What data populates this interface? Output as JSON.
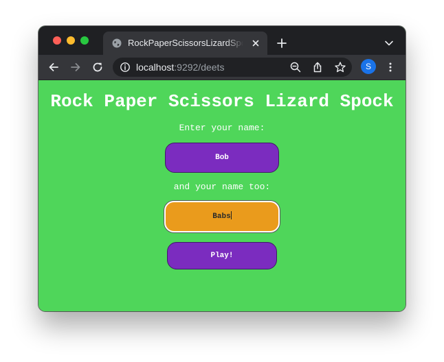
{
  "browser": {
    "tab_title": "RockPaperScissorsLizardSpock",
    "url_host": "localhost",
    "url_rest": ":9292/deets",
    "profile_initial": "S",
    "colors": {
      "tabbar_bg": "#1f2023",
      "toolbar_bg": "#35363a",
      "profile_avatar": "#1a73e8"
    },
    "icons": [
      "globe-icon",
      "close-icon",
      "plus-icon",
      "chevron-down-icon",
      "back-arrow-icon",
      "forward-arrow-icon",
      "reload-icon",
      "info-icon",
      "zoom-out-icon",
      "share-icon",
      "star-icon",
      "more-vert-icon"
    ]
  },
  "page": {
    "title": "Rock Paper Scissors Lizard Spock",
    "player1_label": "Enter your name:",
    "player1_value": "Bob",
    "player2_label": "and your name too:",
    "player2_value": "Babs",
    "play_button": "Play!",
    "colors": {
      "background": "#4fd65a",
      "field_purple": "#7b2cbf",
      "field_orange_focused": "#ea9b1c",
      "text": "#ffffff"
    }
  }
}
